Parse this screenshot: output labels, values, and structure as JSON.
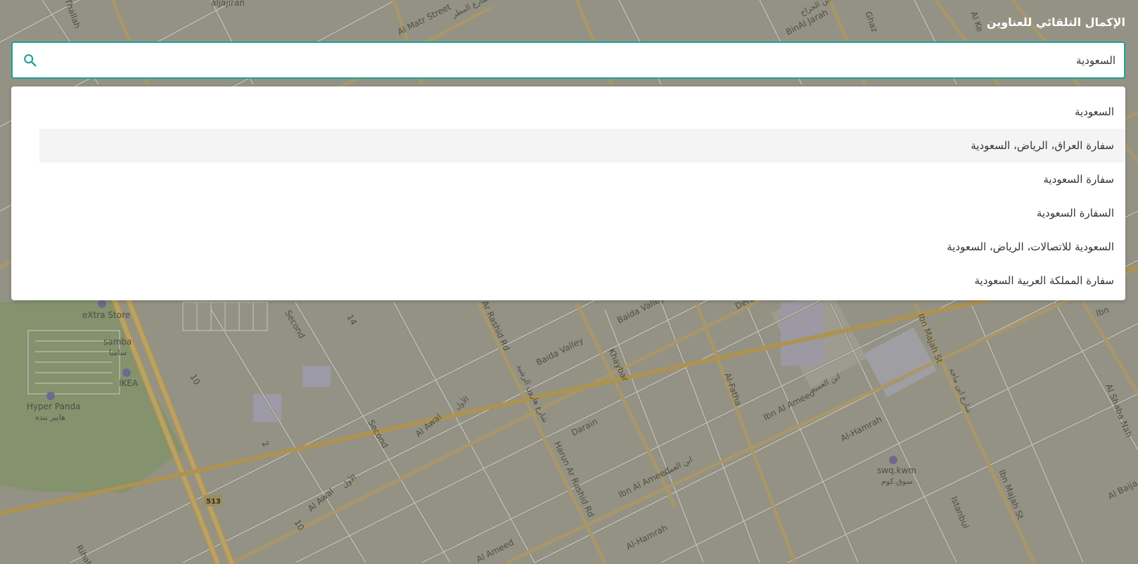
{
  "panel": {
    "title": "الإكمال التلقائي للعناوين"
  },
  "search": {
    "value": "السعودية",
    "icon": "search-icon",
    "accent_color": "#1aa39a"
  },
  "suggestions": [
    {
      "label": "السعودية",
      "highlighted": false
    },
    {
      "label": "سفارة العراق، الرياض، السعودية",
      "highlighted": true
    },
    {
      "label": "سفارة السعودية",
      "highlighted": false
    },
    {
      "label": "السفارة السعودية",
      "highlighted": false
    },
    {
      "label": "السعودية للاتصالات، الرياض، السعودية",
      "highlighted": false
    },
    {
      "label": "سفارة المملكة العربية السعودية",
      "highlighted": false
    }
  ],
  "map": {
    "labels": {
      "aljajiran": "aljajiran",
      "al_matr_street": "Al Matr Street",
      "al_matr_ar": "شارع المطر",
      "binaljarah": "BinAl Jarah",
      "binaljarah_ar": "شارع ابن الجراح",
      "thallah": "Thallah",
      "extra_store": "eXtra Store",
      "samba": "samba",
      "samba_ar": "سامبا",
      "ikea": "IKEA",
      "hyper_panda": "Hyper Panda",
      "hyper_panda_ar": "هايبر بنده",
      "second": "Second",
      "second_2": "Second",
      "fourteen": "14",
      "ten": "10",
      "ten_2": "10",
      "two": "2",
      "al_awal": "Al Awal",
      "al_awal_ar": "الأول",
      "al_awal_2": "Al Awal",
      "al_awal_ar_2": "الأول",
      "shield_513": "513",
      "rihab": "Rihab",
      "ar_rashid_rd": "Ar Rashid Rd",
      "harun_ar_rashid_ar": "شارع هارون الرشيد",
      "harun_ar_rashid_rd": "Harun Ar Rashid Rd",
      "baida_valley": "Baida Valley",
      "baida_valley_2": "Baida Valley",
      "khaybar": "Khaybar",
      "darain": "Darain",
      "al_fatha": "Al-Fatha",
      "ibn_al_ameed": "Ibn Al Ameed",
      "ibn_al_ameed_ar": "ابن العميد",
      "ibn_al_ameed_2": "Ibn Al Ameed",
      "ibn_al_ameed_ar_2": "ابن العميد",
      "al_hamrah": "Al-Hamrah",
      "al_hamrah_2": "Al-Hamrah",
      "al_ameed": "Al Ameed",
      "al_ameed_ar": "ابن العميد",
      "swq_kwm": "swq.kwm",
      "swq_kwm_ar": "سوق.كوم",
      "ibn_majah": "Ibn Majah St",
      "ibn_majah_ar": "شارع ابن ماجه",
      "ibn_majah_2": "Ibn Majah St",
      "ibn_majah_ar_2": "شارع ابن ماجه",
      "istanbul": "Istanbul",
      "al_shaba_nah": "Al Shaba Nah",
      "al_baija": "Al Baija",
      "ibn": "Ibn",
      "dera": "Dera",
      "na": "na",
      "ki": "Al Ke",
      "ghaz": "Ghaz"
    },
    "colors": {
      "land": "#9c9a8c",
      "park": "#8a9a72",
      "block": "#a8a698",
      "major_road": "#b99a52",
      "minor_road": "#c4c2bb"
    }
  }
}
